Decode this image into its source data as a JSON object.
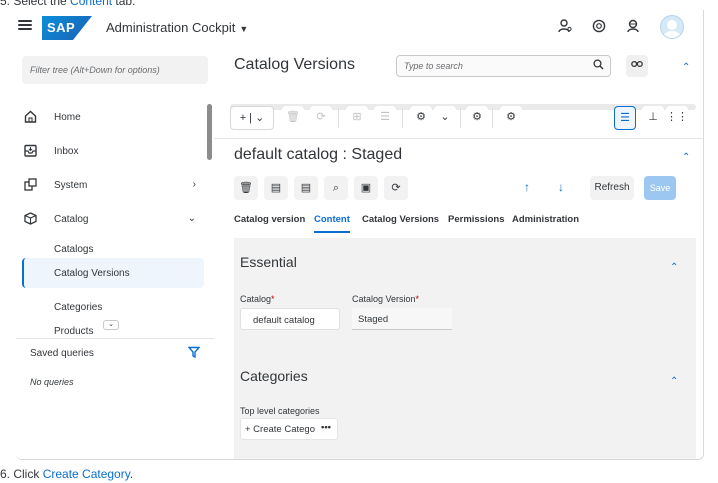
{
  "captions": {
    "step5_prefix": "5. Select the ",
    "step5_link": "Content",
    "step5_suffix": " tab.",
    "step6_prefix": "6. Click ",
    "step6_link": "Create Category",
    "step6_suffix": "."
  },
  "shell": {
    "logo_text": "SAP",
    "app_title": "Administration Cockpit",
    "icons": [
      "user-settings-icon",
      "help-icon",
      "notifications-icon",
      "user-avatar"
    ]
  },
  "nav": {
    "filter_placeholder": "Filter tree (Alt+Down for options)",
    "items": [
      {
        "label": "Home",
        "icon": "home-icon"
      },
      {
        "label": "Inbox",
        "icon": "inbox-icon"
      },
      {
        "label": "System",
        "icon": "system-icon",
        "chevron": "›"
      },
      {
        "label": "Catalog",
        "icon": "catalog-icon",
        "chevron": "⌄"
      },
      {
        "label": "Catalogs"
      },
      {
        "label": "Catalog Versions",
        "selected": true
      },
      {
        "label": "Categories"
      },
      {
        "label": "Products"
      }
    ],
    "saved_queries_title": "Saved queries",
    "no_queries": "No queries"
  },
  "list": {
    "title": "Catalog Versions",
    "search_placeholder": "Type to search"
  },
  "editor": {
    "title": "default catalog : Staged",
    "refresh_label": "Refresh",
    "save_label": "Save",
    "tabs": [
      {
        "label": "Catalog version",
        "active": false
      },
      {
        "label": "Content",
        "active": true
      },
      {
        "label": "Catalog Versions",
        "active": false
      },
      {
        "label": "Permissions",
        "active": false
      },
      {
        "label": "Administration",
        "active": false
      }
    ]
  },
  "essential": {
    "title": "Essential",
    "catalog_label": "Catalog",
    "catalog_value": "default catalog",
    "version_label": "Catalog Version",
    "version_value": "Staged",
    "required_mark": "*"
  },
  "categories": {
    "title": "Categories",
    "top_level_label": "Top level categories",
    "create_label": "+ Create Catego",
    "more": "•••"
  },
  "colors": {
    "accent": "#0a6ed1",
    "selected_bg": "#eef5fc",
    "save_disabled": "#9cc7f0",
    "required": "#bb0000"
  }
}
